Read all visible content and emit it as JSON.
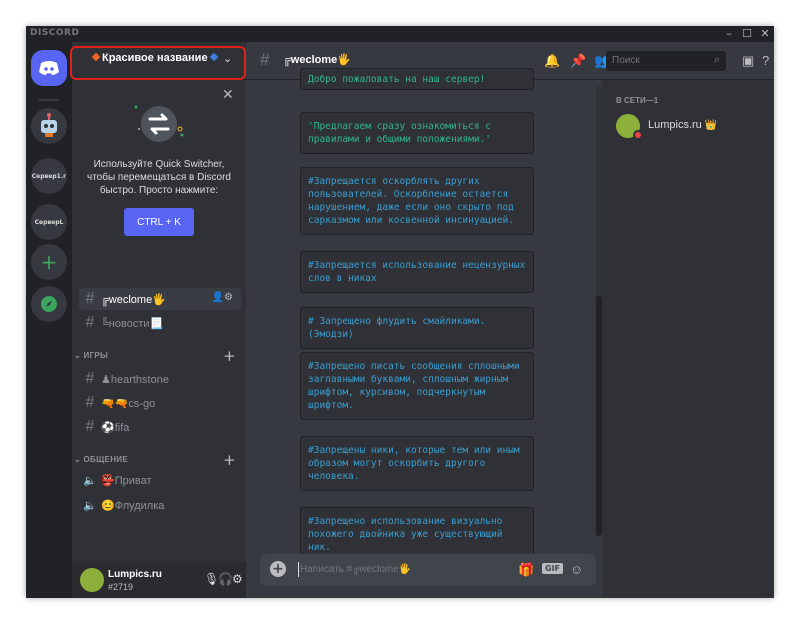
{
  "app": {
    "brand": "DISCORD"
  },
  "window_controls": {
    "minimize": "–",
    "maximize": "☐",
    "close": "✕"
  },
  "rail": {
    "servers": [
      {
        "label": "Сервер1.г"
      },
      {
        "label": "СерверL"
      }
    ],
    "add_label": "+",
    "explore_label": "🧭"
  },
  "guild": {
    "name": "Красивое название"
  },
  "tip": {
    "text": "Используйте Quick Switcher, чтобы перемещаться в Discord быстро. Просто нажмите:",
    "button": "CTRL + K",
    "close": "✕"
  },
  "channels": {
    "uncategorized": [
      {
        "name": "╔weclome🖐",
        "active": true
      },
      {
        "name": "╚новости📃",
        "active": false
      }
    ],
    "categories": [
      {
        "name": "ИГРЫ",
        "channels": [
          {
            "name": "♟hearthstone"
          },
          {
            "name": "🔫🔫cs-go"
          },
          {
            "name": "⚽fifa"
          }
        ]
      },
      {
        "name": "ОБЩЕНИЕ",
        "channels": [
          {
            "name": "👺Приват"
          },
          {
            "name": "😊Флудилка"
          }
        ]
      }
    ]
  },
  "user": {
    "name": "Lumpics.ru",
    "tag": "#2719"
  },
  "topbar": {
    "channel": "╔weclome🖐",
    "search_placeholder": "Поиск"
  },
  "messages": [
    {
      "text": "Добро пожаловать на наш сервер!",
      "color": "#31b48c"
    },
    {
      "text": "'Предлагаем сразу ознакомиться с правилами и общими положениями.'",
      "color": "#31b48c"
    },
    {
      "text": "#Запрещается оскорблять других пользователей. Оскорбление остается нарушением, даже если оно скрыто под сарказмом или косвенной инсинуацией.",
      "color": "#3a9dd0"
    },
    {
      "text": "#Запрещается использование нецензурных слов в никах",
      "color": "#3a9dd0"
    },
    {
      "text": "# Запрещено флудить смайликами.(Эмодзи)",
      "color": "#3a9dd0"
    },
    {
      "text": "#Запрещено писать сообщения сплошными заглавными буквами, сплошным жирным шрифтом, курсивом, подчеркнутым шрифтом.",
      "color": "#3a9dd0"
    },
    {
      "text": "#Запрещены ники, которые тем или иным образом могут оскорбить другого человека.",
      "color": "#3a9dd0"
    },
    {
      "text": "#Запрещено использование визуально похожего двойника уже существующий ник.",
      "color": "#3a9dd0"
    }
  ],
  "composer": {
    "placeholder": "Написать #╔weclome🖐",
    "gif_label": "GIF"
  },
  "members": {
    "header": "В СЕТИ—1",
    "list": [
      {
        "name": "Lumpics.ru",
        "crown": "👑"
      }
    ]
  }
}
